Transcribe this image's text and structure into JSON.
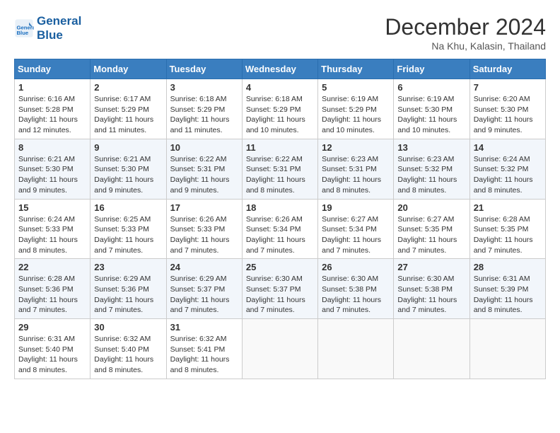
{
  "header": {
    "logo_line1": "General",
    "logo_line2": "Blue",
    "month_year": "December 2024",
    "location": "Na Khu, Kalasin, Thailand"
  },
  "days_of_week": [
    "Sunday",
    "Monday",
    "Tuesday",
    "Wednesday",
    "Thursday",
    "Friday",
    "Saturday"
  ],
  "weeks": [
    [
      {
        "day": 1,
        "sunrise": "6:16 AM",
        "sunset": "5:28 PM",
        "daylight": "11 hours and 12 minutes."
      },
      {
        "day": 2,
        "sunrise": "6:17 AM",
        "sunset": "5:29 PM",
        "daylight": "11 hours and 11 minutes."
      },
      {
        "day": 3,
        "sunrise": "6:18 AM",
        "sunset": "5:29 PM",
        "daylight": "11 hours and 11 minutes."
      },
      {
        "day": 4,
        "sunrise": "6:18 AM",
        "sunset": "5:29 PM",
        "daylight": "11 hours and 10 minutes."
      },
      {
        "day": 5,
        "sunrise": "6:19 AM",
        "sunset": "5:29 PM",
        "daylight": "11 hours and 10 minutes."
      },
      {
        "day": 6,
        "sunrise": "6:19 AM",
        "sunset": "5:30 PM",
        "daylight": "11 hours and 10 minutes."
      },
      {
        "day": 7,
        "sunrise": "6:20 AM",
        "sunset": "5:30 PM",
        "daylight": "11 hours and 9 minutes."
      }
    ],
    [
      {
        "day": 8,
        "sunrise": "6:21 AM",
        "sunset": "5:30 PM",
        "daylight": "11 hours and 9 minutes."
      },
      {
        "day": 9,
        "sunrise": "6:21 AM",
        "sunset": "5:30 PM",
        "daylight": "11 hours and 9 minutes."
      },
      {
        "day": 10,
        "sunrise": "6:22 AM",
        "sunset": "5:31 PM",
        "daylight": "11 hours and 9 minutes."
      },
      {
        "day": 11,
        "sunrise": "6:22 AM",
        "sunset": "5:31 PM",
        "daylight": "11 hours and 8 minutes."
      },
      {
        "day": 12,
        "sunrise": "6:23 AM",
        "sunset": "5:31 PM",
        "daylight": "11 hours and 8 minutes."
      },
      {
        "day": 13,
        "sunrise": "6:23 AM",
        "sunset": "5:32 PM",
        "daylight": "11 hours and 8 minutes."
      },
      {
        "day": 14,
        "sunrise": "6:24 AM",
        "sunset": "5:32 PM",
        "daylight": "11 hours and 8 minutes."
      }
    ],
    [
      {
        "day": 15,
        "sunrise": "6:24 AM",
        "sunset": "5:33 PM",
        "daylight": "11 hours and 8 minutes."
      },
      {
        "day": 16,
        "sunrise": "6:25 AM",
        "sunset": "5:33 PM",
        "daylight": "11 hours and 7 minutes."
      },
      {
        "day": 17,
        "sunrise": "6:26 AM",
        "sunset": "5:33 PM",
        "daylight": "11 hours and 7 minutes."
      },
      {
        "day": 18,
        "sunrise": "6:26 AM",
        "sunset": "5:34 PM",
        "daylight": "11 hours and 7 minutes."
      },
      {
        "day": 19,
        "sunrise": "6:27 AM",
        "sunset": "5:34 PM",
        "daylight": "11 hours and 7 minutes."
      },
      {
        "day": 20,
        "sunrise": "6:27 AM",
        "sunset": "5:35 PM",
        "daylight": "11 hours and 7 minutes."
      },
      {
        "day": 21,
        "sunrise": "6:28 AM",
        "sunset": "5:35 PM",
        "daylight": "11 hours and 7 minutes."
      }
    ],
    [
      {
        "day": 22,
        "sunrise": "6:28 AM",
        "sunset": "5:36 PM",
        "daylight": "11 hours and 7 minutes."
      },
      {
        "day": 23,
        "sunrise": "6:29 AM",
        "sunset": "5:36 PM",
        "daylight": "11 hours and 7 minutes."
      },
      {
        "day": 24,
        "sunrise": "6:29 AM",
        "sunset": "5:37 PM",
        "daylight": "11 hours and 7 minutes."
      },
      {
        "day": 25,
        "sunrise": "6:30 AM",
        "sunset": "5:37 PM",
        "daylight": "11 hours and 7 minutes."
      },
      {
        "day": 26,
        "sunrise": "6:30 AM",
        "sunset": "5:38 PM",
        "daylight": "11 hours and 7 minutes."
      },
      {
        "day": 27,
        "sunrise": "6:30 AM",
        "sunset": "5:38 PM",
        "daylight": "11 hours and 7 minutes."
      },
      {
        "day": 28,
        "sunrise": "6:31 AM",
        "sunset": "5:39 PM",
        "daylight": "11 hours and 8 minutes."
      }
    ],
    [
      {
        "day": 29,
        "sunrise": "6:31 AM",
        "sunset": "5:40 PM",
        "daylight": "11 hours and 8 minutes."
      },
      {
        "day": 30,
        "sunrise": "6:32 AM",
        "sunset": "5:40 PM",
        "daylight": "11 hours and 8 minutes."
      },
      {
        "day": 31,
        "sunrise": "6:32 AM",
        "sunset": "5:41 PM",
        "daylight": "11 hours and 8 minutes."
      },
      null,
      null,
      null,
      null
    ]
  ],
  "labels": {
    "sunrise": "Sunrise:",
    "sunset": "Sunset:",
    "daylight": "Daylight:"
  }
}
